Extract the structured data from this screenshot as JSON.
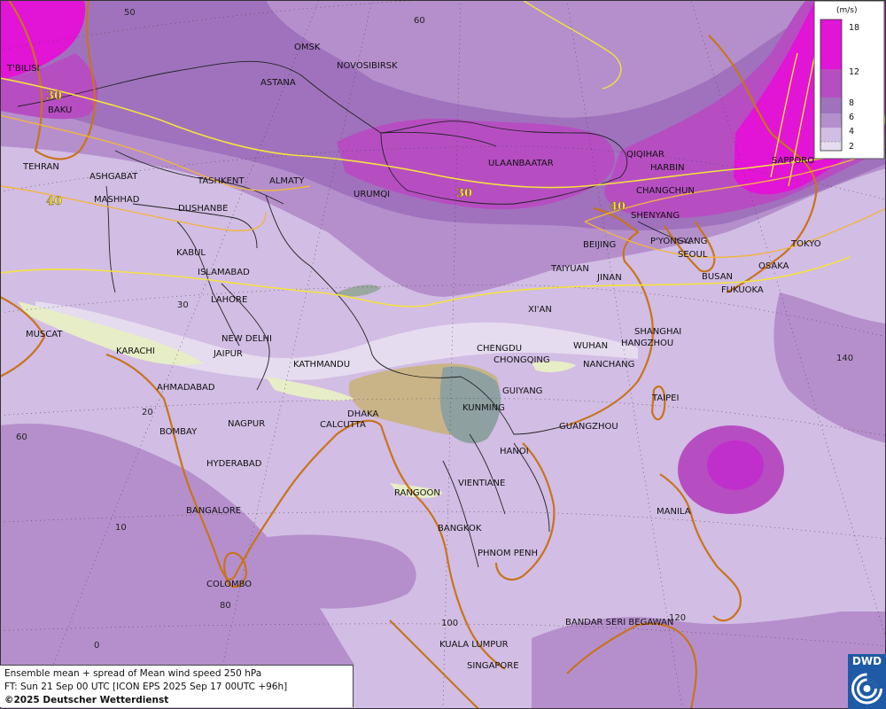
{
  "legend": {
    "unit": "(m/s)",
    "ticks": [
      "18",
      "12",
      "8",
      "6",
      "4",
      "2"
    ],
    "colors": [
      "#e214d6",
      "#b64ec2",
      "#a072bd",
      "#b58fcc",
      "#d2bde4",
      "#e5dcef"
    ]
  },
  "contours": [
    "30",
    "30",
    "40",
    "40"
  ],
  "lat_labels": [
    "50",
    "60",
    "30",
    "20",
    "10",
    "0"
  ],
  "lon_labels": [
    "60",
    "140",
    "80",
    "100",
    "120"
  ],
  "cities": [
    {
      "name": "T'BILISI"
    },
    {
      "name": "BAKU"
    },
    {
      "name": "OMSK"
    },
    {
      "name": "NOVOSIBIRSK"
    },
    {
      "name": "ASTANA"
    },
    {
      "name": "TEHRAN"
    },
    {
      "name": "ASHGABAT"
    },
    {
      "name": "TASHKENT"
    },
    {
      "name": "ALMATY"
    },
    {
      "name": "MASHHAD"
    },
    {
      "name": "DUSHANBE"
    },
    {
      "name": "URUMQI"
    },
    {
      "name": "ULAANBAATAR"
    },
    {
      "name": "QIQIHAR"
    },
    {
      "name": "HARBIN"
    },
    {
      "name": "SAPPORO"
    },
    {
      "name": "CHANGCHUN"
    },
    {
      "name": "SHENYANG"
    },
    {
      "name": "KABUL"
    },
    {
      "name": "BEIJING"
    },
    {
      "name": "P'YONGYANG"
    },
    {
      "name": "SEOUL"
    },
    {
      "name": "TOKYO"
    },
    {
      "name": "ISLAMABAD"
    },
    {
      "name": "TAIYUAN"
    },
    {
      "name": "JINAN"
    },
    {
      "name": "BUSAN"
    },
    {
      "name": "OSAKA"
    },
    {
      "name": "FUKUOKA"
    },
    {
      "name": "LAHORE"
    },
    {
      "name": "XI'AN"
    },
    {
      "name": "SHANGHAI"
    },
    {
      "name": "MUSCAT"
    },
    {
      "name": "NEW DELHI"
    },
    {
      "name": "HANGZHOU"
    },
    {
      "name": "WUHAN"
    },
    {
      "name": "CHENGDU"
    },
    {
      "name": "KARACHI"
    },
    {
      "name": "JAIPUR"
    },
    {
      "name": "KATHMANDU"
    },
    {
      "name": "CHONGQING"
    },
    {
      "name": "NANCHANG"
    },
    {
      "name": "AHMADABAD"
    },
    {
      "name": "GUIYANG"
    },
    {
      "name": "TAIPEI"
    },
    {
      "name": "KUNMING"
    },
    {
      "name": "DHAKA"
    },
    {
      "name": "NAGPUR"
    },
    {
      "name": "CALCUTTA"
    },
    {
      "name": "GUANGZHOU"
    },
    {
      "name": "BOMBAY"
    },
    {
      "name": "HANOI"
    },
    {
      "name": "HYDERABAD"
    },
    {
      "name": "VIENTIANE"
    },
    {
      "name": "RANGOON"
    },
    {
      "name": "BANGALORE"
    },
    {
      "name": "MANILA"
    },
    {
      "name": "BANGKOK"
    },
    {
      "name": "PHNOM PENH"
    },
    {
      "name": "COLOMBO"
    },
    {
      "name": "BANDAR SERI BEGAWAN"
    },
    {
      "name": "KUALA LUMPUR"
    },
    {
      "name": "SINGAPORE"
    }
  ],
  "caption": {
    "line1": "Ensemble mean + spread of Mean wind speed 250 hPa",
    "line2": "FT: Sun 21 Sep 00 UTC [ICON EPS 2025 Sep 17 00UTC +96h]",
    "line3": "©2025 Deutscher Wetterdienst"
  },
  "logo": {
    "text": "DWD"
  }
}
